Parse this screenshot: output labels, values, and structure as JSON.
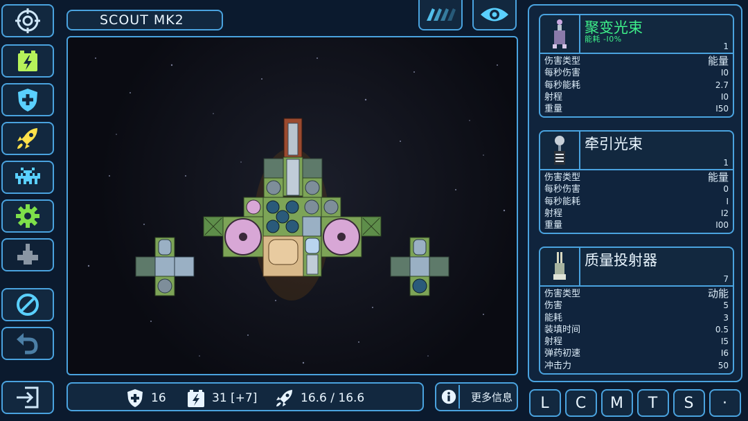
{
  "header": {
    "ship_name": "SCOUT MK2"
  },
  "sidebar": {
    "items": [
      {
        "icon": "target-icon"
      },
      {
        "icon": "battery-icon"
      },
      {
        "icon": "shield-icon"
      },
      {
        "icon": "rocket-icon"
      },
      {
        "icon": "invader-icon"
      },
      {
        "icon": "gear-icon"
      },
      {
        "icon": "ship-icon"
      },
      {
        "icon": "no-icon"
      },
      {
        "icon": "undo-icon"
      },
      {
        "icon": "exit-icon"
      }
    ]
  },
  "stats": {
    "shield": "16",
    "power": "31 [+7]",
    "thrust": "16.6 / 16.6"
  },
  "info_button": {
    "label": "更多信息"
  },
  "weapons": [
    {
      "name": "聚变光束",
      "subtitle": "能耗 -I0%",
      "level": "1",
      "rows": [
        {
          "label": "伤害类型",
          "value": "能量"
        },
        {
          "label": "每秒伤害",
          "value": "I0"
        },
        {
          "label": "每秒能耗",
          "value": "2.7"
        },
        {
          "label": "射程",
          "value": "I0"
        },
        {
          "label": "重量",
          "value": "I50"
        }
      ]
    },
    {
      "name": "牵引光束",
      "level": "1",
      "rows": [
        {
          "label": "伤害类型",
          "value": "能量"
        },
        {
          "label": "每秒伤害",
          "value": "0"
        },
        {
          "label": "每秒能耗",
          "value": "I"
        },
        {
          "label": "射程",
          "value": "I2"
        },
        {
          "label": "重量",
          "value": "I00"
        }
      ]
    },
    {
      "name": "质量投射器",
      "level": "7",
      "rows": [
        {
          "label": "伤害类型",
          "value": "动能"
        },
        {
          "label": "伤害",
          "value": "5"
        },
        {
          "label": "能耗",
          "value": "3"
        },
        {
          "label": "装填时间",
          "value": "0.5"
        },
        {
          "label": "射程",
          "value": "I5"
        },
        {
          "label": "弹药初速",
          "value": "I6"
        },
        {
          "label": "冲击力",
          "value": "50"
        }
      ]
    }
  ],
  "bottom_tabs": [
    "L",
    "C",
    "M",
    "T",
    "S",
    "·"
  ],
  "colors": {
    "accent": "#4aa3df",
    "panel": "#12283f",
    "highlight": "#3ef08a"
  }
}
